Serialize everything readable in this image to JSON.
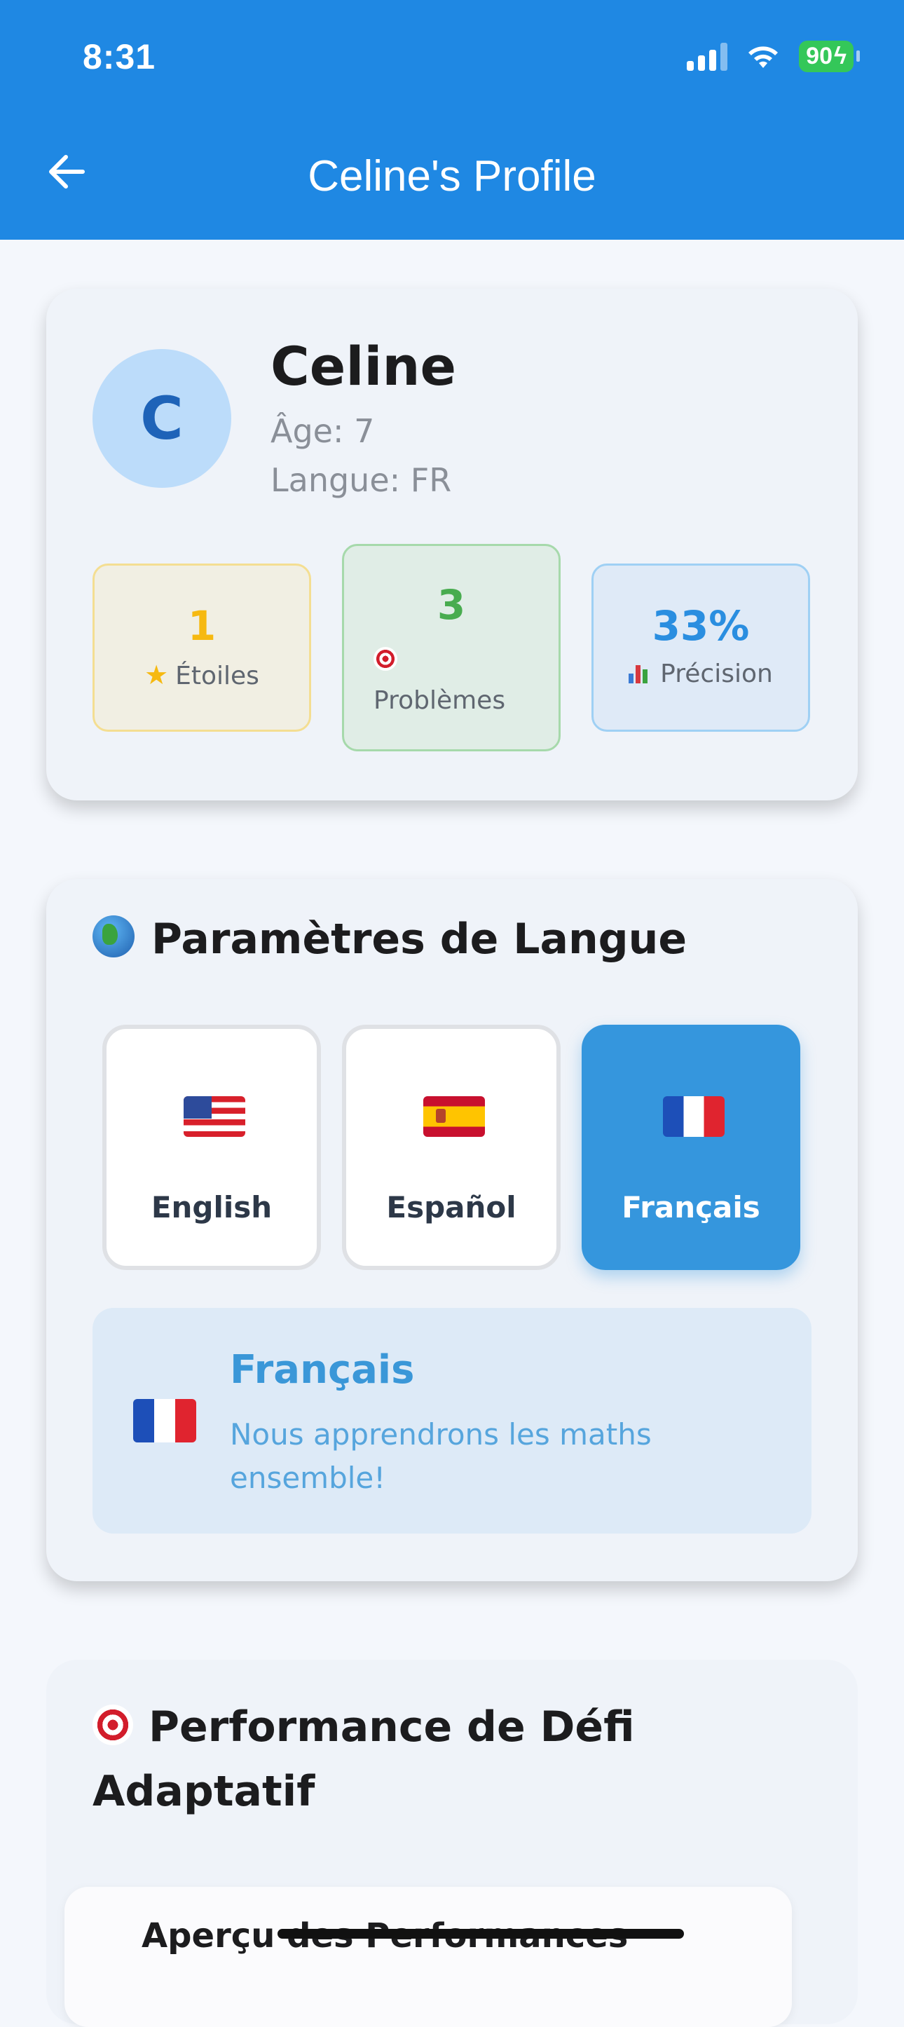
{
  "status_bar": {
    "time": "8:31",
    "battery": "90"
  },
  "header": {
    "title": "Celine's Profile"
  },
  "profile": {
    "initial": "C",
    "name": "Celine",
    "age": "Âge: 7",
    "language": "Langue: FR"
  },
  "stats": {
    "stars": {
      "value": "1",
      "label": "Étoiles"
    },
    "problems": {
      "value": "3",
      "label": "Problèmes"
    },
    "accuracy": {
      "value": "33%",
      "label": "Précision"
    }
  },
  "language_settings": {
    "title": "Paramètres de Langue",
    "options": [
      {
        "label": "English",
        "flag": "us-flag"
      },
      {
        "label": "Español",
        "flag": "es-flag"
      },
      {
        "label": "Français",
        "flag": "fr-flag",
        "selected": true
      }
    ],
    "current": {
      "name": "Français",
      "description": "Nous apprendrons les maths ensemble!"
    }
  },
  "performance": {
    "title_line1": "Performance de Défi",
    "title_line2": "Adaptatif",
    "overview_title": "Aperçu des Performances"
  },
  "colors": {
    "header": "#1f88e3",
    "accent": "#3596dd",
    "stars": "#f6b911",
    "problems": "#48ac4f",
    "accuracy": "#2a8ee0"
  }
}
